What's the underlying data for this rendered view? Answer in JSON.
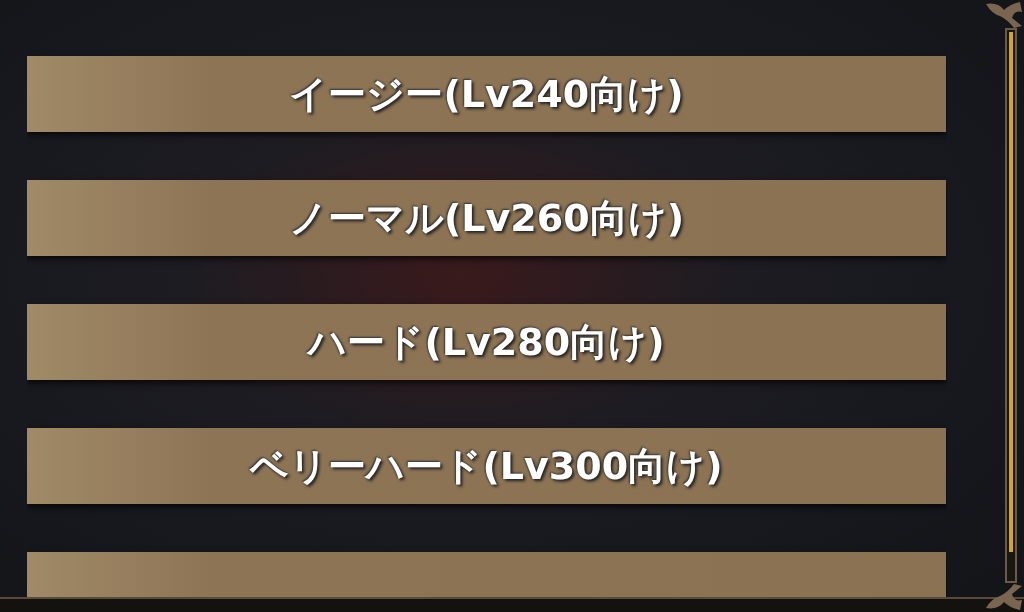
{
  "difficulty_options": [
    {
      "label": "イージー(Lv240向け)"
    },
    {
      "label": "ノーマル(Lv260向け)"
    },
    {
      "label": "ハード(Lv280向け)"
    },
    {
      "label": "ベリーハード(Lv300向け)"
    }
  ]
}
